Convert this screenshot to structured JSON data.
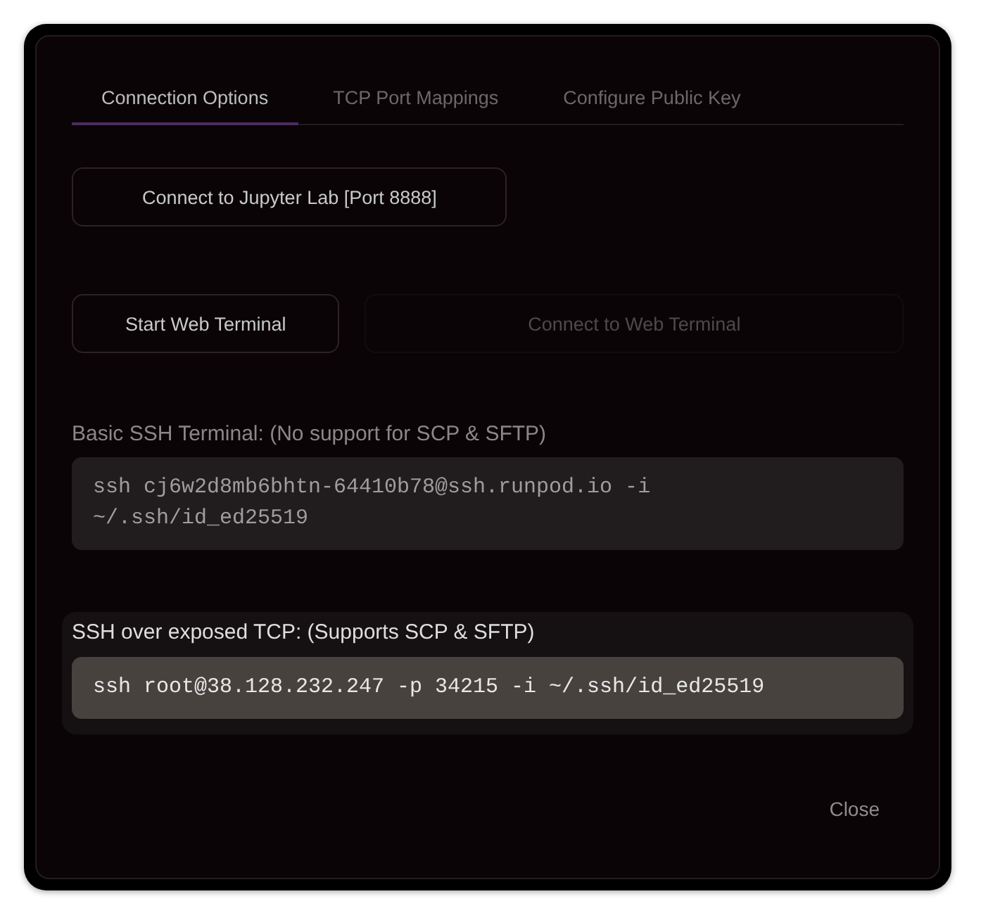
{
  "tabs": [
    {
      "label": "Connection Options",
      "selected": true
    },
    {
      "label": "TCP Port Mappings",
      "selected": false
    },
    {
      "label": "Configure Public Key",
      "selected": false
    }
  ],
  "button_rows": [
    {
      "buttons": [
        {
          "label": "Connect to Jupyter Lab [Port 8888]",
          "disabled": false
        }
      ]
    },
    {
      "buttons": [
        {
          "label": "Start Web Terminal",
          "disabled": false
        },
        {
          "label": "Connect to Web Terminal",
          "disabled": true
        }
      ]
    }
  ],
  "ssh_sections": [
    {
      "label": "Basic SSH Terminal: (No support for SCP & SFTP)",
      "command": "ssh cj6w2d8mb6bhtn-64410b78@ssh.runpod.io -i ~/.ssh/id_ed25519",
      "highlighted": false
    },
    {
      "label": "SSH over exposed TCP: (Supports SCP & SFTP)",
      "command": "ssh root@38.128.232.247 -p 34215 -i ~/.ssh/id_ed25519",
      "highlighted": true
    }
  ],
  "footer": {
    "close_button": "Close"
  }
}
